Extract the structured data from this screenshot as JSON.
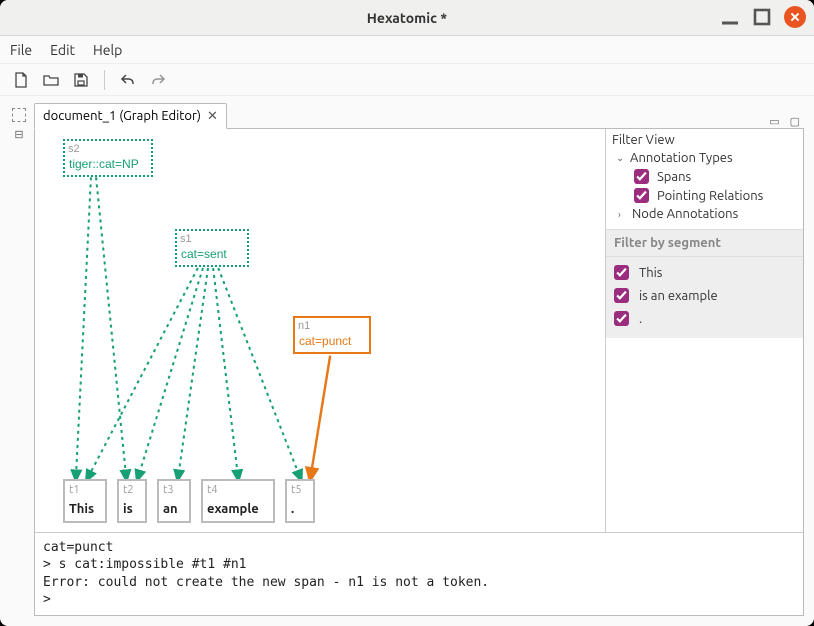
{
  "window": {
    "title": "Hexatomic *"
  },
  "menu": {
    "file": "File",
    "edit": "Edit",
    "help": "Help"
  },
  "tab": {
    "label": "document_1 (Graph Editor)"
  },
  "filter": {
    "title": "Filter View",
    "annotation_types_label": "Annotation Types",
    "spans_label": "Spans",
    "pointing_relations_label": "Pointing Relations",
    "node_annotations_label": "Node Annotations",
    "segment_header": "Filter by segment",
    "segments": {
      "s0": "This",
      "s1": "is an example",
      "s2": "."
    }
  },
  "graph": {
    "nodes": {
      "s2": {
        "id": "s2",
        "label": "tiger::cat=NP"
      },
      "s1": {
        "id": "s1",
        "label": "cat=sent"
      },
      "n1": {
        "id": "n1",
        "label": "cat=punct"
      }
    },
    "tokens": {
      "t1": {
        "id": "t1",
        "word": "This"
      },
      "t2": {
        "id": "t2",
        "word": "is"
      },
      "t3": {
        "id": "t3",
        "word": "an"
      },
      "t4": {
        "id": "t4",
        "word": "example"
      },
      "t5": {
        "id": "t5",
        "word": "."
      }
    }
  },
  "console": {
    "line1": "cat=punct",
    "line2": "> s cat:impossible #t1 #n1",
    "line3": "Error: could not create the new span - n1 is not a token.",
    "line4": ">"
  }
}
